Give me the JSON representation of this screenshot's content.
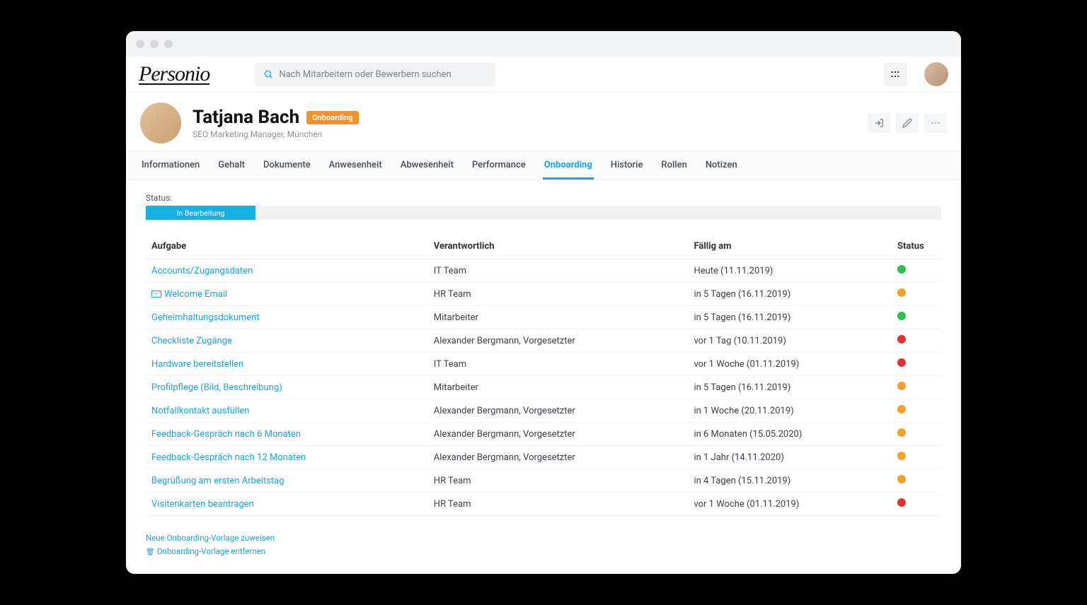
{
  "app": {
    "logo": "Personio"
  },
  "search": {
    "placeholder": "Nach Mitarbeitern oder Bewerbern suchen"
  },
  "profile": {
    "name": "Tatjana Bach",
    "badge": "Onboarding",
    "subtitle": "SEO Marketing Manager, München"
  },
  "tabs": [
    "Informationen",
    "Gehalt",
    "Dokumente",
    "Anwesenheit",
    "Abwesenheit",
    "Performance",
    "Onboarding",
    "Historie",
    "Rollen",
    "Notizen"
  ],
  "active_tab": "Onboarding",
  "status": {
    "label": "Status:",
    "chip": "In Bearbeitung"
  },
  "table": {
    "headers": {
      "task": "Aufgabe",
      "responsible": "Verantwortlich",
      "due": "Fällig am",
      "status": "Status"
    },
    "rows": [
      {
        "task": "Accounts/Zugangsdaten",
        "icon": null,
        "responsible": "IT Team",
        "due": "Heute (11.11.2019)",
        "status": "green"
      },
      {
        "task": "Welcome Email",
        "icon": "mail",
        "responsible": "HR Team",
        "due": "in 5 Tagen (16.11.2019)",
        "status": "orange"
      },
      {
        "task": "Geheimhaltungsdokument",
        "icon": null,
        "responsible": "Mitarbeiter",
        "due": "in 5 Tagen (16.11.2019)",
        "status": "green"
      },
      {
        "task": "Checkliste Zugänge",
        "icon": null,
        "responsible": "Alexander Bergmann, Vorgesetzter",
        "due": "vor 1 Tag (10.11.2019)",
        "status": "red"
      },
      {
        "task": "Hardware bereitstellen",
        "icon": null,
        "responsible": "IT Team",
        "due": "vor 1 Woche (01.11.2019)",
        "status": "red"
      },
      {
        "task": "Profilpflege (Bild, Beschreibung)",
        "icon": null,
        "responsible": "Mitarbeiter",
        "due": "in 5 Tagen (16.11.2019)",
        "status": "orange"
      },
      {
        "task": "Notfallkontakt ausfüllen",
        "icon": null,
        "responsible": "Alexander Bergmann, Vorgesetzter",
        "due": "in 1 Woche (20.11.2019)",
        "status": "orange"
      },
      {
        "task": "Feedback-Gespräch nach 6 Monaten",
        "icon": null,
        "responsible": "Alexander Bergmann, Vorgesetzter",
        "due": "in 6 Monaten (15.05.2020)",
        "status": "orange"
      },
      {
        "task": "Feedback-Gespräch nach 12 Monaten",
        "icon": null,
        "responsible": "Alexander Bergmann, Vorgesetzter",
        "due": "in 1 Jahr (14.11.2020)",
        "status": "orange"
      },
      {
        "task": "Begrüßung am ersten Arbeitstag",
        "icon": null,
        "responsible": "HR Team",
        "due": "in 4 Tagen (15.11.2019)",
        "status": "orange"
      },
      {
        "task": "Visitenkarten beantragen",
        "icon": null,
        "responsible": "HR Team",
        "due": "vor 1 Woche (01.11.2019)",
        "status": "red"
      }
    ]
  },
  "footer": {
    "assign": "Neue Onboarding-Vorlage zuweisen",
    "remove": "Onboarding-Vorlage entfernen"
  }
}
